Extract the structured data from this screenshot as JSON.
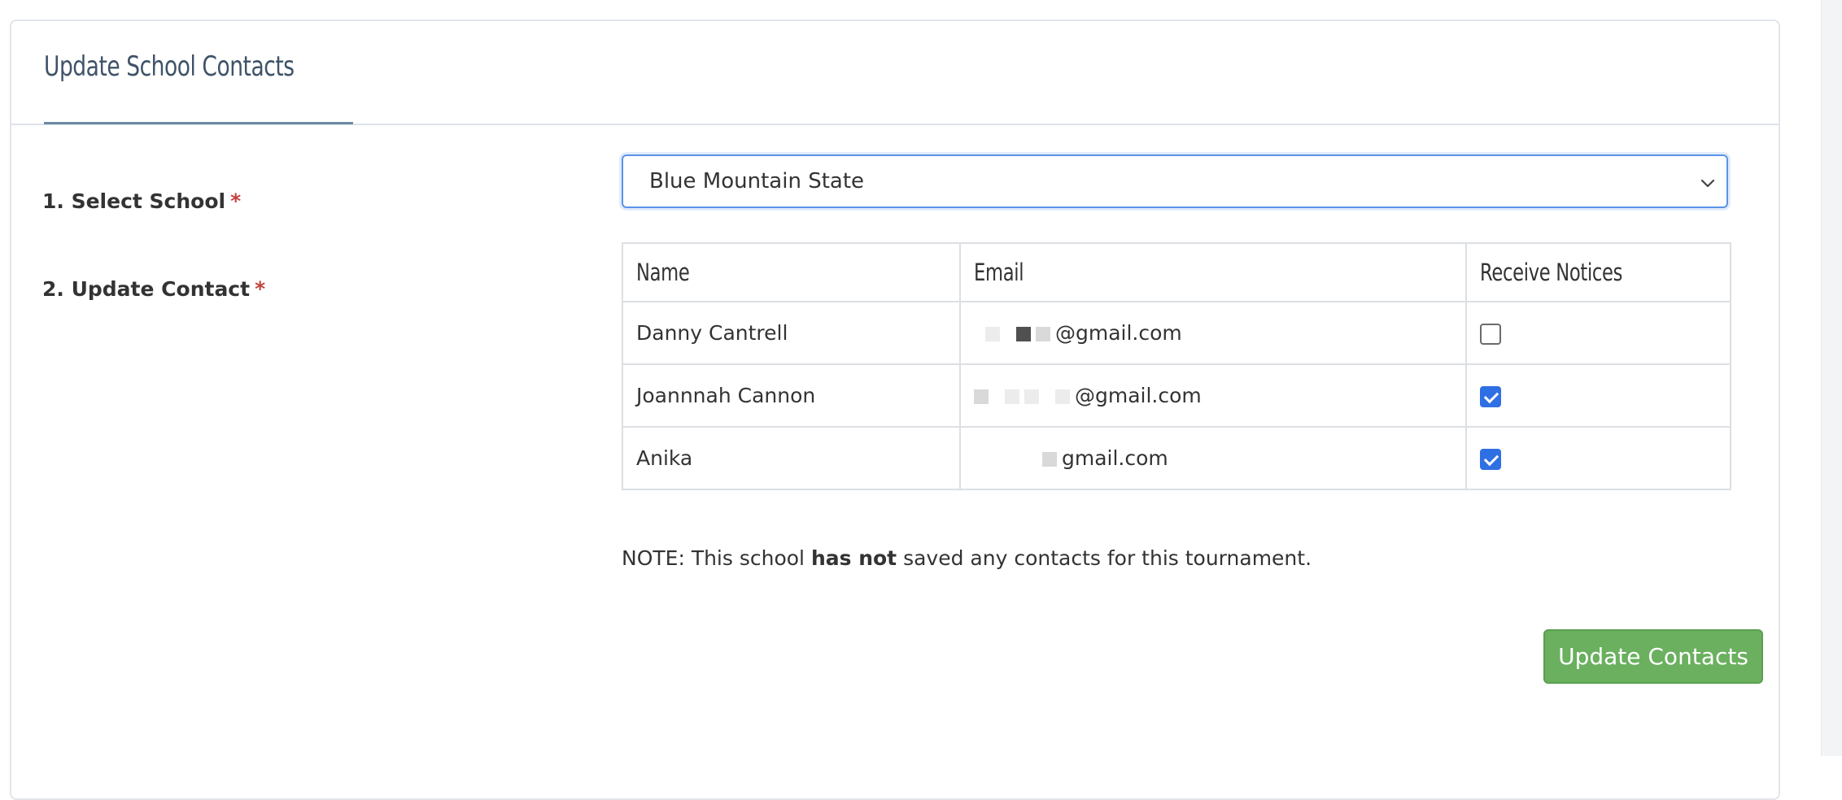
{
  "panel": {
    "title": "Update School Contacts"
  },
  "form": {
    "select_school_label": "1. Select School",
    "update_contact_label": "2. Update Contact",
    "required_mark": "*",
    "school_select": {
      "selected": "Blue Mountain State"
    }
  },
  "table": {
    "headers": [
      "Name",
      "Email",
      "Receive Notices"
    ],
    "rows": [
      {
        "name": "Danny Cantrell",
        "email_visible": "@gmail.com",
        "receive_notices": false
      },
      {
        "name": "Joannnah Cannon",
        "email_visible": "@gmail.com",
        "receive_notices": true
      },
      {
        "name": "Anika",
        "email_visible": "gmail.com",
        "receive_notices": true
      }
    ]
  },
  "note": {
    "prefix": "NOTE: This school ",
    "emphasis": "has not",
    "suffix": " saved any contacts for this tournament."
  },
  "actions": {
    "update_label": "Update Contacts"
  },
  "icons": {
    "select_arrow": "chevron-down-icon"
  },
  "colors": {
    "title": "#3f5368",
    "required": "#c2423e",
    "focus_border": "#5a93e8",
    "checkbox_checked": "#2f6fe4",
    "button_bg": "#6ab05f"
  }
}
